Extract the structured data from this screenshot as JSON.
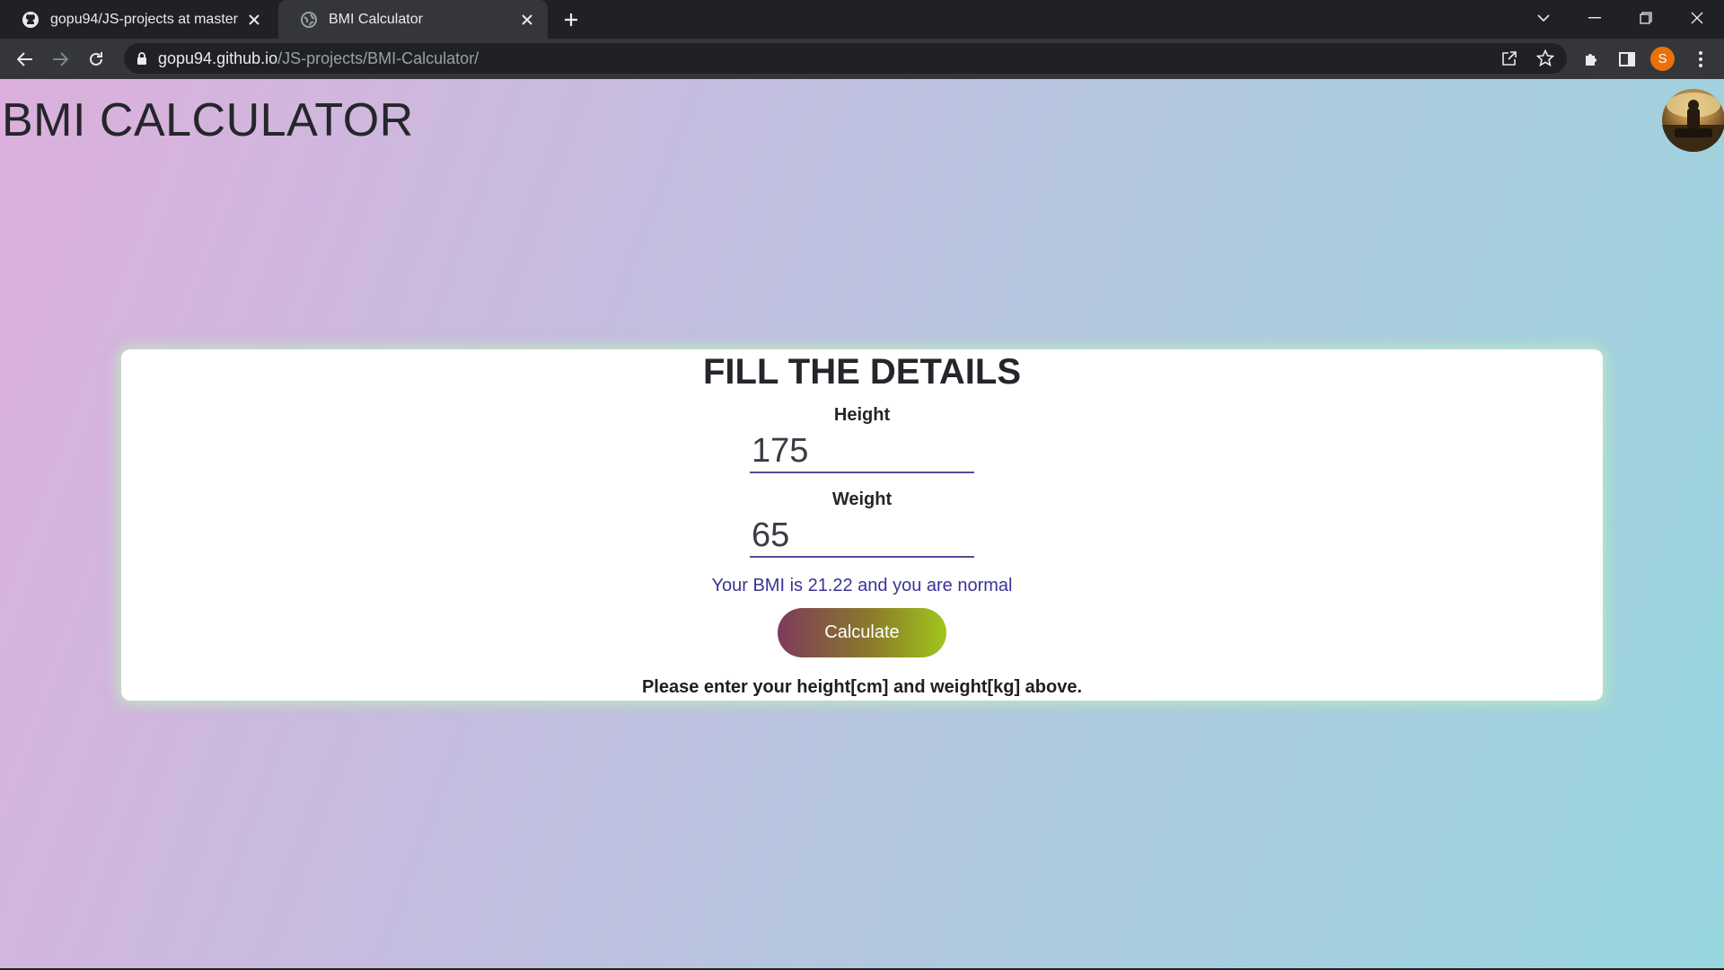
{
  "browser": {
    "tabs": [
      {
        "title": "gopu94/JS-projects at master",
        "icon": "github-icon",
        "active": false
      },
      {
        "title": "BMI Calculator",
        "icon": "globe-icon",
        "active": true
      }
    ],
    "url_host": "gopu94.github.io",
    "url_path": "/JS-projects/BMI-Calculator/",
    "profile_initial": "S",
    "accent": "#e8710a"
  },
  "page": {
    "title": "BMI CALCULATOR",
    "card": {
      "heading": "FILL THE DETAILS",
      "height_label": "Height",
      "height_value": "175",
      "weight_label": "Weight",
      "weight_value": "65",
      "result": "Your BMI is 21.22 and you are normal",
      "button_label": "Calculate",
      "hint": "Please enter your height[cm] and weight[kg] above."
    }
  }
}
